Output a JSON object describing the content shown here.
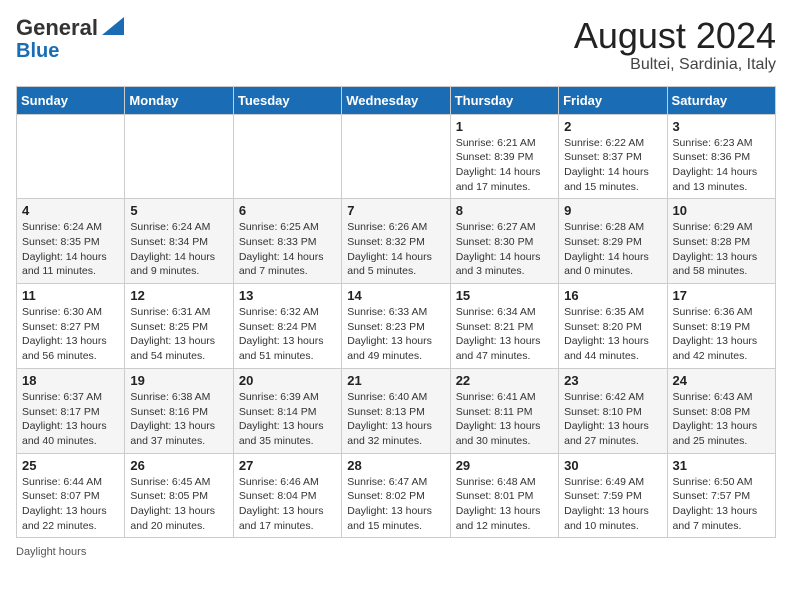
{
  "header": {
    "logo_line1": "General",
    "logo_line2": "Blue",
    "month_year": "August 2024",
    "location": "Bultei, Sardinia, Italy"
  },
  "weekdays": [
    "Sunday",
    "Monday",
    "Tuesday",
    "Wednesday",
    "Thursday",
    "Friday",
    "Saturday"
  ],
  "weeks": [
    [
      {
        "day": "",
        "sunrise": "",
        "sunset": "",
        "daylight": ""
      },
      {
        "day": "",
        "sunrise": "",
        "sunset": "",
        "daylight": ""
      },
      {
        "day": "",
        "sunrise": "",
        "sunset": "",
        "daylight": ""
      },
      {
        "day": "",
        "sunrise": "",
        "sunset": "",
        "daylight": ""
      },
      {
        "day": "1",
        "sunrise": "Sunrise: 6:21 AM",
        "sunset": "Sunset: 8:39 PM",
        "daylight": "Daylight: 14 hours and 17 minutes."
      },
      {
        "day": "2",
        "sunrise": "Sunrise: 6:22 AM",
        "sunset": "Sunset: 8:37 PM",
        "daylight": "Daylight: 14 hours and 15 minutes."
      },
      {
        "day": "3",
        "sunrise": "Sunrise: 6:23 AM",
        "sunset": "Sunset: 8:36 PM",
        "daylight": "Daylight: 14 hours and 13 minutes."
      }
    ],
    [
      {
        "day": "4",
        "sunrise": "Sunrise: 6:24 AM",
        "sunset": "Sunset: 8:35 PM",
        "daylight": "Daylight: 14 hours and 11 minutes."
      },
      {
        "day": "5",
        "sunrise": "Sunrise: 6:24 AM",
        "sunset": "Sunset: 8:34 PM",
        "daylight": "Daylight: 14 hours and 9 minutes."
      },
      {
        "day": "6",
        "sunrise": "Sunrise: 6:25 AM",
        "sunset": "Sunset: 8:33 PM",
        "daylight": "Daylight: 14 hours and 7 minutes."
      },
      {
        "day": "7",
        "sunrise": "Sunrise: 6:26 AM",
        "sunset": "Sunset: 8:32 PM",
        "daylight": "Daylight: 14 hours and 5 minutes."
      },
      {
        "day": "8",
        "sunrise": "Sunrise: 6:27 AM",
        "sunset": "Sunset: 8:30 PM",
        "daylight": "Daylight: 14 hours and 3 minutes."
      },
      {
        "day": "9",
        "sunrise": "Sunrise: 6:28 AM",
        "sunset": "Sunset: 8:29 PM",
        "daylight": "Daylight: 14 hours and 0 minutes."
      },
      {
        "day": "10",
        "sunrise": "Sunrise: 6:29 AM",
        "sunset": "Sunset: 8:28 PM",
        "daylight": "Daylight: 13 hours and 58 minutes."
      }
    ],
    [
      {
        "day": "11",
        "sunrise": "Sunrise: 6:30 AM",
        "sunset": "Sunset: 8:27 PM",
        "daylight": "Daylight: 13 hours and 56 minutes."
      },
      {
        "day": "12",
        "sunrise": "Sunrise: 6:31 AM",
        "sunset": "Sunset: 8:25 PM",
        "daylight": "Daylight: 13 hours and 54 minutes."
      },
      {
        "day": "13",
        "sunrise": "Sunrise: 6:32 AM",
        "sunset": "Sunset: 8:24 PM",
        "daylight": "Daylight: 13 hours and 51 minutes."
      },
      {
        "day": "14",
        "sunrise": "Sunrise: 6:33 AM",
        "sunset": "Sunset: 8:23 PM",
        "daylight": "Daylight: 13 hours and 49 minutes."
      },
      {
        "day": "15",
        "sunrise": "Sunrise: 6:34 AM",
        "sunset": "Sunset: 8:21 PM",
        "daylight": "Daylight: 13 hours and 47 minutes."
      },
      {
        "day": "16",
        "sunrise": "Sunrise: 6:35 AM",
        "sunset": "Sunset: 8:20 PM",
        "daylight": "Daylight: 13 hours and 44 minutes."
      },
      {
        "day": "17",
        "sunrise": "Sunrise: 6:36 AM",
        "sunset": "Sunset: 8:19 PM",
        "daylight": "Daylight: 13 hours and 42 minutes."
      }
    ],
    [
      {
        "day": "18",
        "sunrise": "Sunrise: 6:37 AM",
        "sunset": "Sunset: 8:17 PM",
        "daylight": "Daylight: 13 hours and 40 minutes."
      },
      {
        "day": "19",
        "sunrise": "Sunrise: 6:38 AM",
        "sunset": "Sunset: 8:16 PM",
        "daylight": "Daylight: 13 hours and 37 minutes."
      },
      {
        "day": "20",
        "sunrise": "Sunrise: 6:39 AM",
        "sunset": "Sunset: 8:14 PM",
        "daylight": "Daylight: 13 hours and 35 minutes."
      },
      {
        "day": "21",
        "sunrise": "Sunrise: 6:40 AM",
        "sunset": "Sunset: 8:13 PM",
        "daylight": "Daylight: 13 hours and 32 minutes."
      },
      {
        "day": "22",
        "sunrise": "Sunrise: 6:41 AM",
        "sunset": "Sunset: 8:11 PM",
        "daylight": "Daylight: 13 hours and 30 minutes."
      },
      {
        "day": "23",
        "sunrise": "Sunrise: 6:42 AM",
        "sunset": "Sunset: 8:10 PM",
        "daylight": "Daylight: 13 hours and 27 minutes."
      },
      {
        "day": "24",
        "sunrise": "Sunrise: 6:43 AM",
        "sunset": "Sunset: 8:08 PM",
        "daylight": "Daylight: 13 hours and 25 minutes."
      }
    ],
    [
      {
        "day": "25",
        "sunrise": "Sunrise: 6:44 AM",
        "sunset": "Sunset: 8:07 PM",
        "daylight": "Daylight: 13 hours and 22 minutes."
      },
      {
        "day": "26",
        "sunrise": "Sunrise: 6:45 AM",
        "sunset": "Sunset: 8:05 PM",
        "daylight": "Daylight: 13 hours and 20 minutes."
      },
      {
        "day": "27",
        "sunrise": "Sunrise: 6:46 AM",
        "sunset": "Sunset: 8:04 PM",
        "daylight": "Daylight: 13 hours and 17 minutes."
      },
      {
        "day": "28",
        "sunrise": "Sunrise: 6:47 AM",
        "sunset": "Sunset: 8:02 PM",
        "daylight": "Daylight: 13 hours and 15 minutes."
      },
      {
        "day": "29",
        "sunrise": "Sunrise: 6:48 AM",
        "sunset": "Sunset: 8:01 PM",
        "daylight": "Daylight: 13 hours and 12 minutes."
      },
      {
        "day": "30",
        "sunrise": "Sunrise: 6:49 AM",
        "sunset": "Sunset: 7:59 PM",
        "daylight": "Daylight: 13 hours and 10 minutes."
      },
      {
        "day": "31",
        "sunrise": "Sunrise: 6:50 AM",
        "sunset": "Sunset: 7:57 PM",
        "daylight": "Daylight: 13 hours and 7 minutes."
      }
    ]
  ],
  "footer": {
    "daylight_label": "Daylight hours"
  }
}
